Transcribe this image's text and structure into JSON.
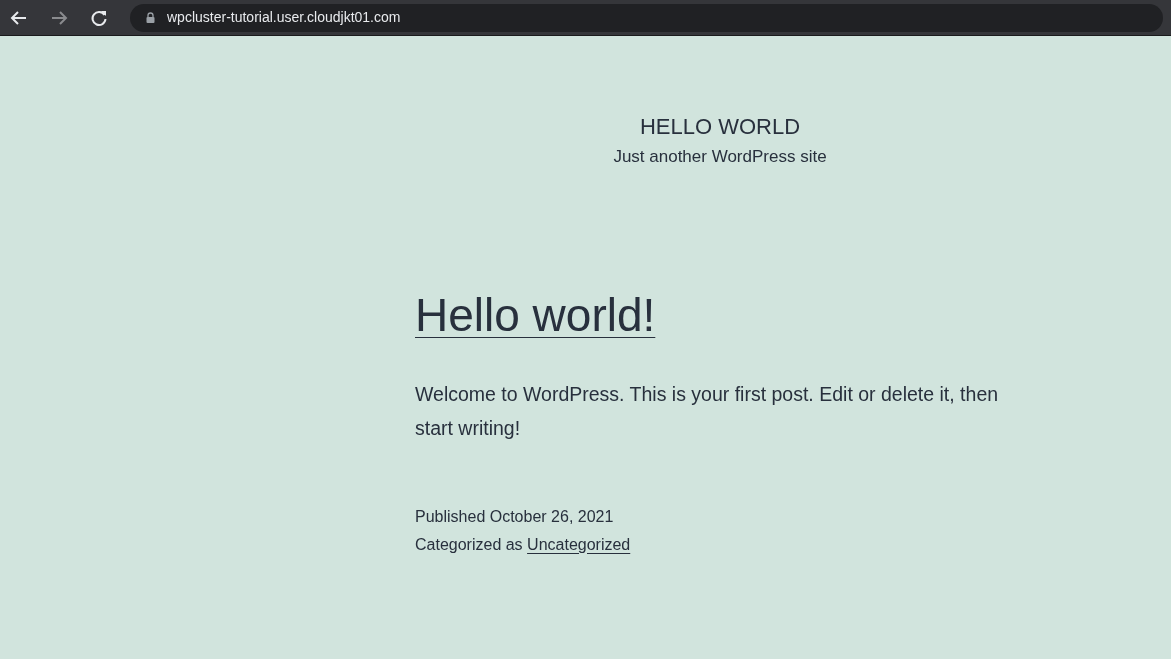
{
  "browser": {
    "nav_buttons": [
      {
        "kind": "back",
        "disabled": false
      },
      {
        "kind": "forward",
        "disabled": true
      },
      {
        "kind": "reload",
        "disabled": false
      }
    ],
    "secure": true,
    "url": "wpcluster-tutorial.user.cloudjkt01.com"
  },
  "site": {
    "title": "HELLO WORLD",
    "tagline": "Just another WordPress site"
  },
  "post": {
    "title": "Hello world!",
    "body": "Welcome to WordPress. This is your first post. Edit or delete it, then start writing!",
    "published": "Published October 26, 2021",
    "category_label": "Categorized as",
    "category": "Uncategorized"
  }
}
